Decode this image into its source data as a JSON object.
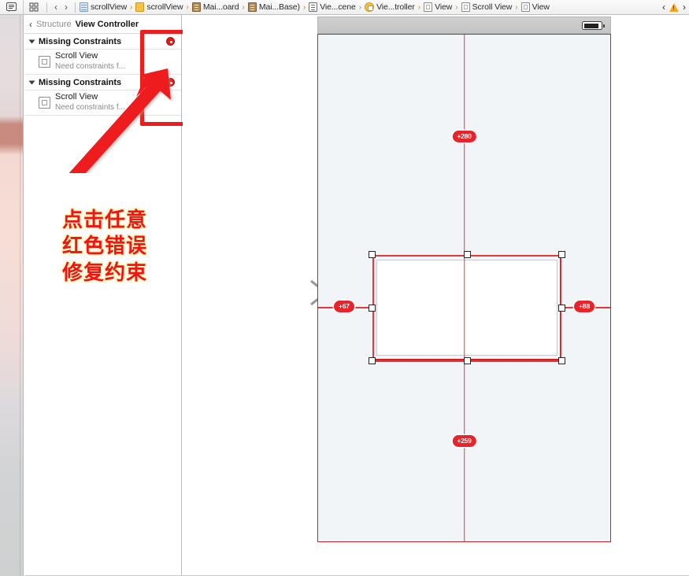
{
  "jump_bar": {
    "icons": {
      "left_panel": "document-outline-icon",
      "grid": "grid-icon",
      "back": "back-chevron-icon",
      "forward": "forward-chevron-icon",
      "warning": "warning-triangle-icon",
      "overflow": "forward-chevron-icon"
    },
    "breadcrumbs": [
      {
        "label": "scrollView",
        "icon": "project-document-icon"
      },
      {
        "label": "scrollView",
        "icon": "folder-icon"
      },
      {
        "label": "Mai...oard",
        "icon": "storyboard-icon"
      },
      {
        "label": "Mai...Base)",
        "icon": "storyboard-icon"
      },
      {
        "label": "Vie...cene",
        "icon": "scene-icon"
      },
      {
        "label": "Vie...troller",
        "icon": "view-controller-icon"
      },
      {
        "label": "View",
        "icon": "view-icon"
      },
      {
        "label": "Scroll View",
        "icon": "view-icon"
      },
      {
        "label": "View",
        "icon": "view-icon"
      }
    ],
    "separator": "›"
  },
  "navigator": {
    "back_chevron": "‹",
    "scope_label": "Structure",
    "title": "View Controller",
    "groups": [
      {
        "label": "Missing Constraints",
        "badge": "error-badge",
        "issues": [
          {
            "title": "Scroll View",
            "desc": "Need constraints f...",
            "icon": "view-icon"
          }
        ]
      },
      {
        "label": "Missing Constraints",
        "badge": "error-badge",
        "issues": [
          {
            "title": "Scroll View",
            "desc": "Need constraints f...",
            "icon": "view-icon"
          }
        ]
      }
    ]
  },
  "annotation": {
    "box": "red-highlight-box",
    "arrow": "red-pointer-arrow",
    "callout_lines": [
      "点击任意",
      "红色错误",
      "修复约束"
    ],
    "colors": {
      "red": "#ee1c1c",
      "text_red": "#f21414",
      "halo": "#fff7c0"
    }
  },
  "canvas": {
    "pointer_arrow": "gray-pointer-arrow",
    "device": {
      "status_bar": {
        "battery": "battery-icon"
      },
      "selected_view": {
        "name": "selected-view",
        "handles": [
          "tl",
          "tc",
          "tr",
          "ml",
          "mr",
          "bl",
          "bc",
          "br"
        ]
      },
      "constraints": [
        {
          "id": "top-constraint",
          "value": "+280",
          "position": "top"
        },
        {
          "id": "leading-constraint",
          "value": "+67",
          "position": "left"
        },
        {
          "id": "trailing-constraint",
          "value": "+88",
          "position": "right"
        },
        {
          "id": "bottom-constraint",
          "value": "+259",
          "position": "bottom"
        }
      ]
    },
    "colors": {
      "constraint_red": "#e03b3b",
      "pill_red": "#e8232a",
      "device_bg": "#f2f5f8"
    }
  }
}
